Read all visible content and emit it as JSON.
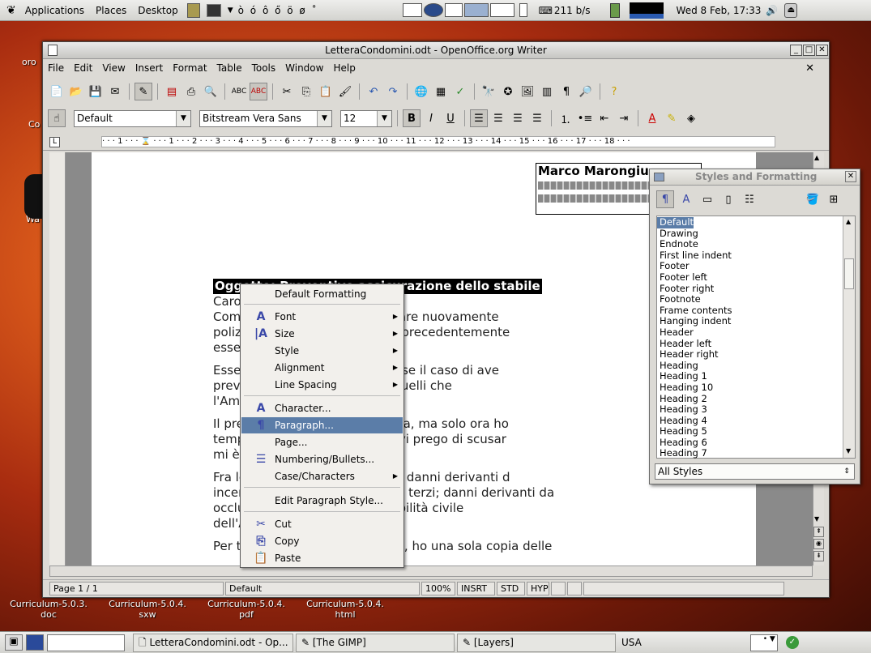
{
  "top_panel": {
    "menus": [
      "Applications",
      "Places",
      "Desktop"
    ],
    "chars": "ò ó ô ő ö ø ˚",
    "network": "211 b/s",
    "clock": "Wed  8 Feb, 17:33"
  },
  "desktop": {
    "icons": [
      "Curriculum-5.0.3.\ndoc",
      "Curriculum-5.0.4.\nsxw",
      "Curriculum-5.0.4.\npdf",
      "Curriculum-5.0.4.\nhtml"
    ],
    "left_labels": [
      "oro",
      "Co",
      "Wa"
    ]
  },
  "window": {
    "title": "LetteraCondomini.odt - OpenOffice.org Writer",
    "menus": [
      "File",
      "Edit",
      "View",
      "Insert",
      "Format",
      "Table",
      "Tools",
      "Window",
      "Help"
    ],
    "paragraph_style": "Default",
    "font_name": "Bitstream Vera Sans",
    "font_size": "12",
    "ruler_marks": "· · · 1 · · · ⌛ · · · 1 · · · 2 · · · 3 · · · 4 · · · 5 · · · 6 · · · 7 · · · 8 · · · 9 · · · 10 · · · 11 · · · 12 · · · 13 · · · 14 · · · 15 · · · 16 · · · 17 · · · 18 · · ·"
  },
  "document": {
    "sender_name": "Marco Marongiu",
    "subject": "Oggetto: Preventivo assicurazione dello stabile",
    "lines": [
      "Caro Condo",
      "Come sapr                              si è deciso di stipulare nuovamente",
      "polizza di a                            e, dopo che quella precedentemente",
      "essere è st                              za rinnovarla.",
      "Essendo i n                              ho pensato che fosse il caso di ave",
      "preventivo                               o confrontare con quelli  che",
      "l'Amministr                              mente fornire.",
      "Il preventiv                             diverse settimane fa, ma solo ora ho",
      "tempo di sc                              r accompagnarlo, vi prego di scusar",
      "mi è stato i",
      "Fra le garar                             rite nel preventivo: danni derivanti d",
      "incendio, fu                             sabilità civile verso terzi; danni derivanti da",
      "occlusione                               condotta; responsabilità civile",
      "dell'Ammin",
      "Per tutti i d                            senti sul preventivo, ho una sola copia delle"
    ]
  },
  "context_menu": {
    "items": [
      {
        "label": "Default Formatting"
      },
      {
        "label": "Font",
        "sub": true
      },
      {
        "label": "Size",
        "sub": true
      },
      {
        "label": "Style",
        "sub": true
      },
      {
        "label": "Alignment",
        "sub": true
      },
      {
        "label": "Line Spacing",
        "sub": true
      },
      {
        "label": "Character..."
      },
      {
        "label": "Paragraph..."
      },
      {
        "label": "Page..."
      },
      {
        "label": "Numbering/Bullets..."
      },
      {
        "label": "Case/Characters",
        "sub": true
      },
      {
        "label": "Edit Paragraph Style..."
      },
      {
        "label": "Cut"
      },
      {
        "label": "Copy"
      },
      {
        "label": "Paste"
      }
    ],
    "highlighted": "Paragraph..."
  },
  "styles_panel": {
    "title": "Styles and Formatting",
    "styles": [
      "Default",
      "Drawing",
      "Endnote",
      "First line indent",
      "Footer",
      "Footer left",
      "Footer right",
      "Footnote",
      "Frame contents",
      "Hanging indent",
      "Header",
      "Header left",
      "Header right",
      "Heading",
      "Heading 1",
      "Heading 10",
      "Heading 2",
      "Heading 3",
      "Heading 4",
      "Heading 5",
      "Heading 6",
      "Heading 7"
    ],
    "filter": "All Styles"
  },
  "statusbar": {
    "page": "Page 1 / 1",
    "style": "Default",
    "zoom": "100%",
    "insert": "INSRT",
    "std": "STD",
    "hyp": "HYP"
  },
  "taskbar": {
    "tasks": [
      "LetteraCondomini.odt - Op...",
      "[The GIMP]",
      "[Layers]"
    ],
    "keyboard": "USA"
  },
  "colors": {
    "highlight": "#5b7da8",
    "window_bg": "#dcdad5"
  }
}
